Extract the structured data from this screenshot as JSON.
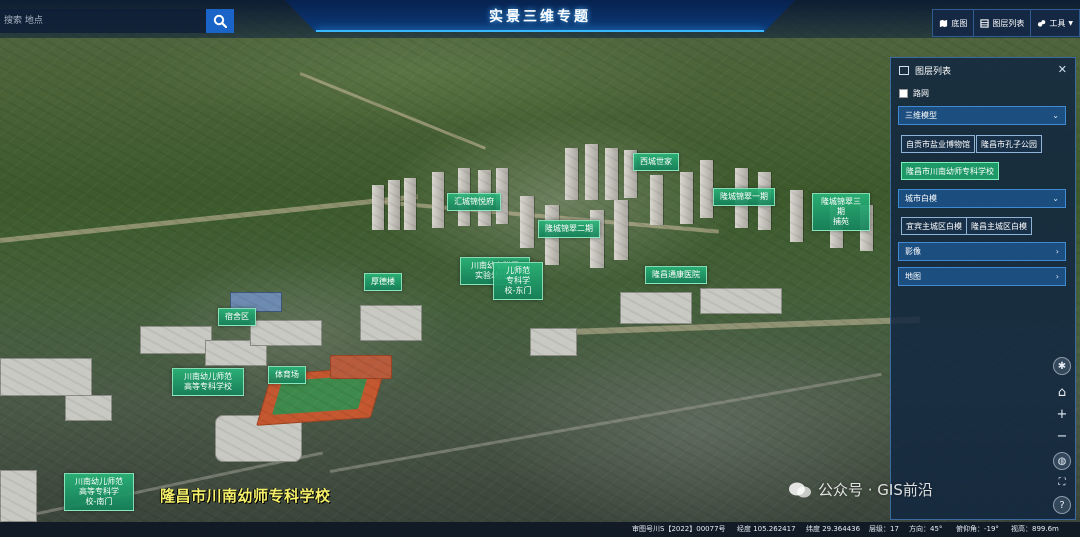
{
  "header": {
    "title": "实景三维专题"
  },
  "search": {
    "placeholder": "搜索 地点"
  },
  "toolbar": {
    "items": [
      "底图",
      "图层列表",
      "工具"
    ]
  },
  "map_labels": [
    "西城世家",
    "汇城锦悦府",
    "隆城锦翠一期",
    "隆城锦翠三期\n捕苑",
    "隆城锦翠二期",
    "川南幼专附属\n实验幼儿园",
    "儿师范\n专科学\n校-东门",
    "隆昌通康医院",
    "厚德楼",
    "宿舍区",
    "体育场",
    "川南幼儿师范\n高等专科学校",
    "川南幼儿师范\n高等专科学\n校-南门"
  ],
  "school_title": "隆昌市川南幼师专科学校",
  "layer_panel": {
    "title": "图层列表",
    "roadnet_label": "路网",
    "roadnet_checked": false,
    "groups": [
      {
        "label": "三维模型",
        "expanded": true,
        "items": [
          "自贡市盐业博物馆",
          "隆昌市孔子公园",
          "隆昌市川南幼师专科学校"
        ],
        "active_item": "隆昌市川南幼师专科学校"
      },
      {
        "label": "城市白模",
        "expanded": true,
        "items": [
          "宜宾主城区白模",
          "隆昌主城区白模"
        ]
      },
      {
        "label": "影像",
        "expanded": false,
        "items": []
      },
      {
        "label": "地图",
        "expanded": false,
        "items": []
      }
    ]
  },
  "watermark": "公众号 · GIS前沿",
  "statusbar": {
    "approval": "审图号川S【2022】00077号",
    "longitude": "经度 105.262417",
    "latitude": "纬度 29.364436",
    "level": "层级：17",
    "direction": "方向：45°",
    "pitch": "俯仰角：-19°",
    "altitude": "视高：899.6m"
  },
  "colors": {
    "accent": "#1a64c8",
    "label_green": "#1f9a6a",
    "school_title": "#f5f06a",
    "panel_bg": "#12263f"
  }
}
